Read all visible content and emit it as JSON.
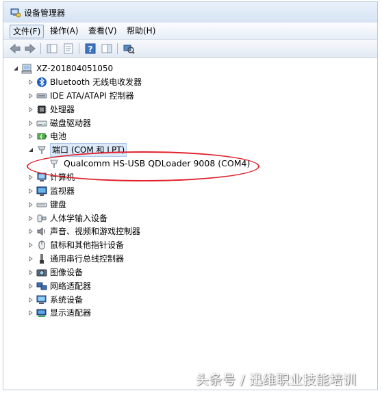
{
  "window": {
    "title": "设备管理器",
    "title_icon": "device-manager-icon"
  },
  "menu": {
    "items": [
      {
        "label": "文件(F)",
        "active": true
      },
      {
        "label": "操作(A)"
      },
      {
        "label": "查看(V)"
      },
      {
        "label": "帮助(H)"
      }
    ]
  },
  "toolbar": {
    "buttons": [
      "back-icon",
      "forward-icon",
      "console-tree-icon",
      "properties-icon",
      "help-icon",
      "show-hide-icon",
      "scan-hardware-icon"
    ]
  },
  "tree": {
    "root": {
      "label": "XZ-201804051050",
      "icon": "computer-icon"
    },
    "items": [
      {
        "label": "Bluetooth 无线电收发器",
        "icon": "bluetooth-icon"
      },
      {
        "label": "IDE ATA/ATAPI 控制器",
        "icon": "ide-controller-icon"
      },
      {
        "label": "处理器",
        "icon": "processor-icon"
      },
      {
        "label": "磁盘驱动器",
        "icon": "disk-drive-icon"
      },
      {
        "label": "电池",
        "icon": "battery-icon"
      },
      {
        "label": "端口 (COM 和 LPT)",
        "icon": "port-icon",
        "expanded": true,
        "selected": true,
        "children": [
          {
            "label": "Qualcomm HS-USB QDLoader 9008 (COM4)",
            "icon": "port-device-icon"
          }
        ]
      },
      {
        "label": "计算机",
        "icon": "computer-category-icon"
      },
      {
        "label": "监视器",
        "icon": "monitor-icon"
      },
      {
        "label": "键盘",
        "icon": "keyboard-icon"
      },
      {
        "label": "人体学输入设备",
        "icon": "hid-icon"
      },
      {
        "label": "声音、视频和游戏控制器",
        "icon": "sound-icon"
      },
      {
        "label": "鼠标和其他指针设备",
        "icon": "mouse-icon"
      },
      {
        "label": "通用串行总线控制器",
        "icon": "usb-icon"
      },
      {
        "label": "图像设备",
        "icon": "camera-icon"
      },
      {
        "label": "网络适配器",
        "icon": "network-icon"
      },
      {
        "label": "系统设备",
        "icon": "system-device-icon"
      },
      {
        "label": "显示适配器",
        "icon": "display-adapter-icon"
      }
    ]
  },
  "watermark": "头条号 / 迅维职业技能培训",
  "colors": {
    "highlight_ring": "#e0212b",
    "selection": "#dbe9f9"
  }
}
